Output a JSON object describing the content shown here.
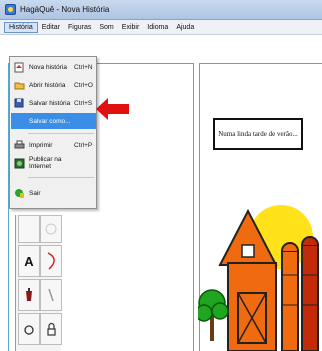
{
  "window": {
    "title": "HagáQuê - Nova História",
    "icon": "app-icon"
  },
  "menubar": {
    "items": [
      "História",
      "Editar",
      "Figuras",
      "Som",
      "Exibir",
      "Idioma",
      "Ajuda"
    ]
  },
  "dropdown": {
    "items": [
      {
        "label": "Nova história",
        "shortcut": "Ctrl+N",
        "icon": "new-story-icon"
      },
      {
        "label": "Abrir história",
        "shortcut": "Ctrl+O",
        "icon": "open-story-icon"
      },
      {
        "label": "Salvar história",
        "shortcut": "Ctrl+S",
        "icon": "save-story-icon"
      },
      {
        "label": "Salvar como...",
        "shortcut": "",
        "icon": ""
      },
      {
        "label": "Imprimir",
        "shortcut": "Ctrl+P",
        "icon": "print-icon"
      },
      {
        "label": "Publicar na Internet",
        "shortcut": "",
        "icon": "publish-icon"
      },
      {
        "label": "Sair",
        "shortcut": "",
        "icon": "exit-icon"
      }
    ],
    "highlighted": "Salvar como..."
  },
  "tools": {
    "text_tool_label": "A",
    "icons": [
      "text-tool-icon",
      "curve-tool-icon",
      "paint-bucket-icon",
      "pencil-icon",
      "zoom-icon",
      "lock-icon"
    ]
  },
  "canvas": {
    "textbox_text": "Numa linda tarde de verão..."
  },
  "colors": {
    "highlight": "#3a8ee6",
    "arrow": "#e01010",
    "page_border": "#5aa7c8"
  }
}
